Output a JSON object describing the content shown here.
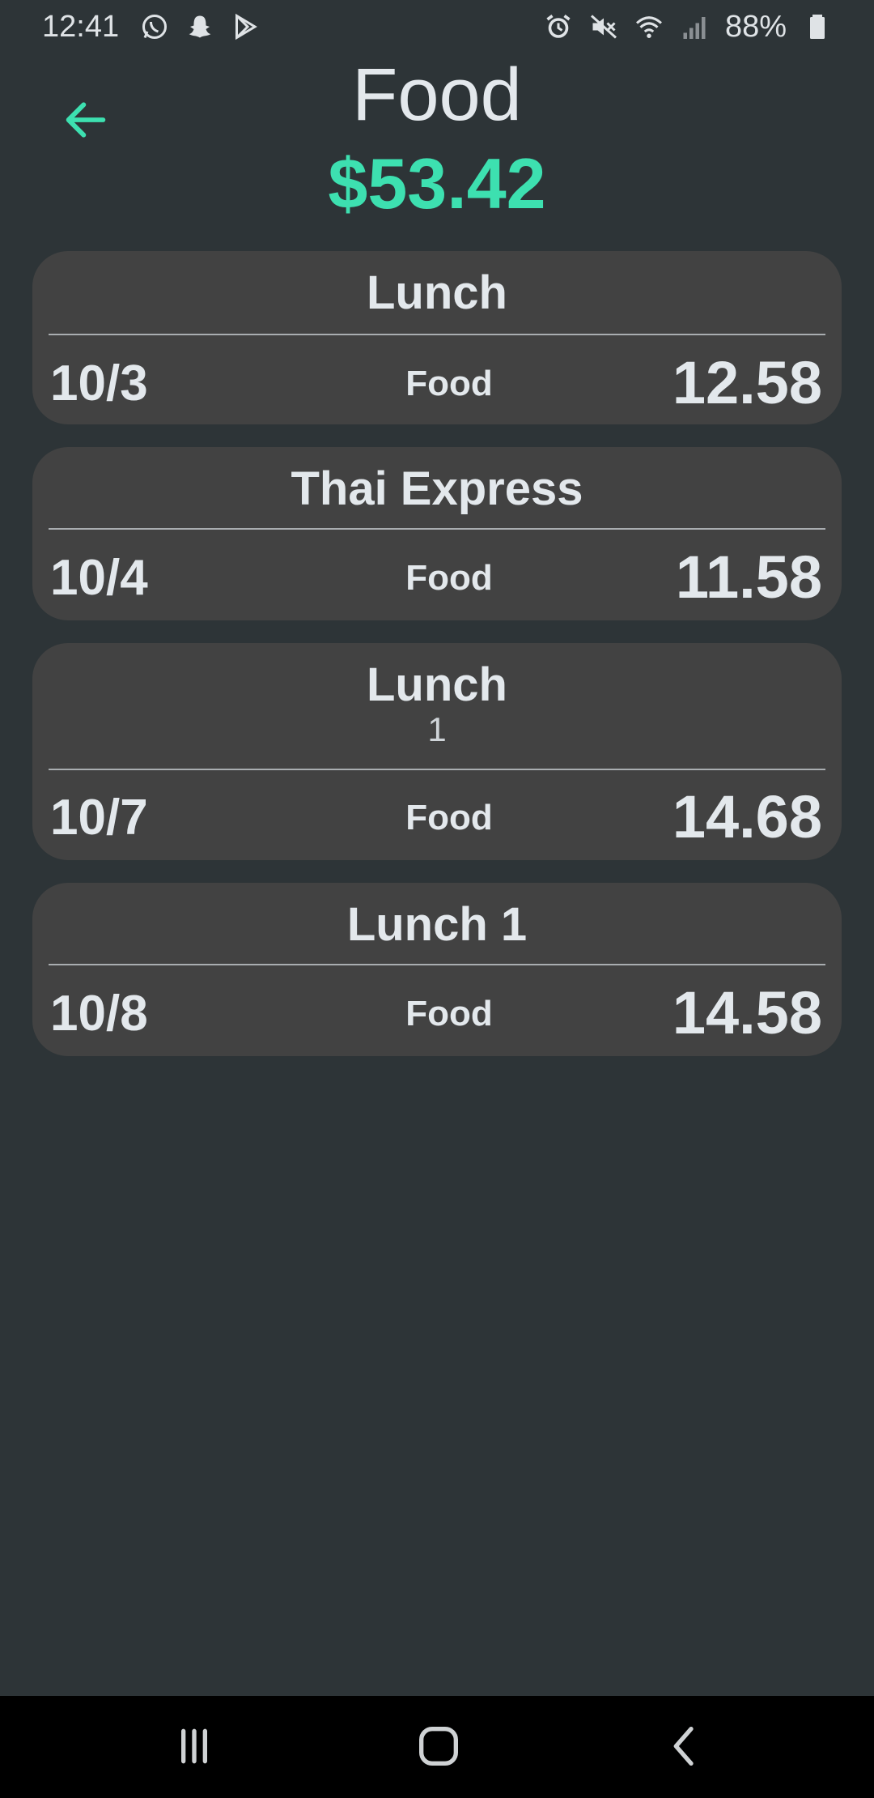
{
  "status_bar": {
    "time": "12:41",
    "battery": "88%",
    "left_icons": [
      "whatsapp-icon",
      "snapchat-icon",
      "play-store-icon"
    ],
    "right_icons": [
      "alarm-icon",
      "mute-icon",
      "wifi-icon",
      "signal-icon",
      "battery-icon"
    ]
  },
  "header": {
    "title": "Food",
    "total": "$53.42",
    "back_icon": "arrow-left-icon"
  },
  "colors": {
    "accent": "#3de0b0",
    "background": "#2d3437",
    "card": "#424242",
    "text": "#e3e8ec"
  },
  "expenses": [
    {
      "title": "Lunch",
      "note": "",
      "date": "10/3",
      "category": "Food",
      "amount": "12.58"
    },
    {
      "title": "Thai Express",
      "note": "",
      "date": "10/4",
      "category": "Food",
      "amount": "11.58"
    },
    {
      "title": "Lunch",
      "note": "1",
      "date": "10/7",
      "category": "Food",
      "amount": "14.68"
    },
    {
      "title": "Lunch 1",
      "note": "",
      "date": "10/8",
      "category": "Food",
      "amount": "14.58"
    }
  ],
  "nav_bar": {
    "icons": [
      "recent-apps-icon",
      "home-icon",
      "back-icon"
    ]
  }
}
